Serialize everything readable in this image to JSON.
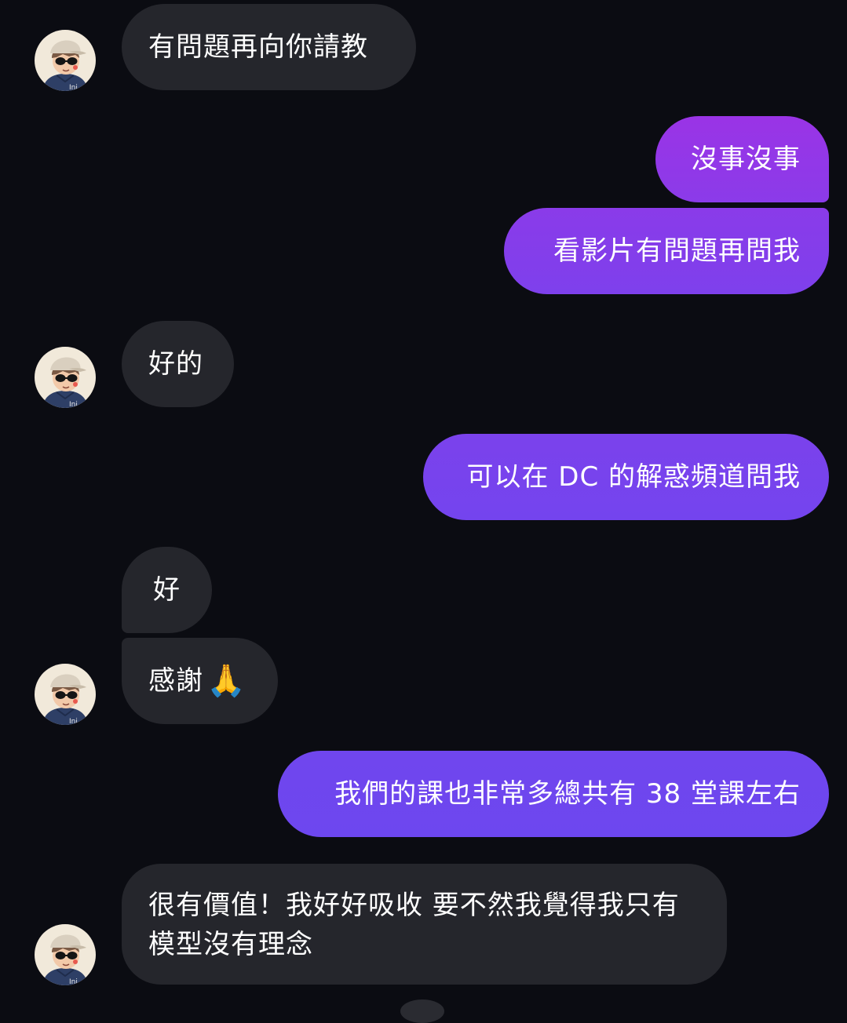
{
  "colors": {
    "background": "#0b0c12",
    "incoming_bubble": "#25262c",
    "outgoing_gradient_top": "#9a34e6",
    "outgoing_gradient_bottom": "#6d45ee",
    "text": "#ffffff"
  },
  "avatar_icon": "cartoon-boy-with-cap-and-sunglasses",
  "messages": [
    {
      "from": "them",
      "text": "有問題再向你請教"
    },
    {
      "from": "me",
      "text": "沒事沒事"
    },
    {
      "from": "me",
      "text": "看影片有問題再問我"
    },
    {
      "from": "them",
      "text": "好的"
    },
    {
      "from": "me",
      "text": "可以在 DC 的解惑頻道問我"
    },
    {
      "from": "them",
      "text": "好"
    },
    {
      "from": "them",
      "text": "感謝",
      "emoji": "🙏"
    },
    {
      "from": "me",
      "text": "我們的課也非常多總共有 38 堂課左右"
    },
    {
      "from": "them",
      "text": "很有價值！我好好吸收 要不然我覺得我只有模型沒有理念"
    }
  ]
}
